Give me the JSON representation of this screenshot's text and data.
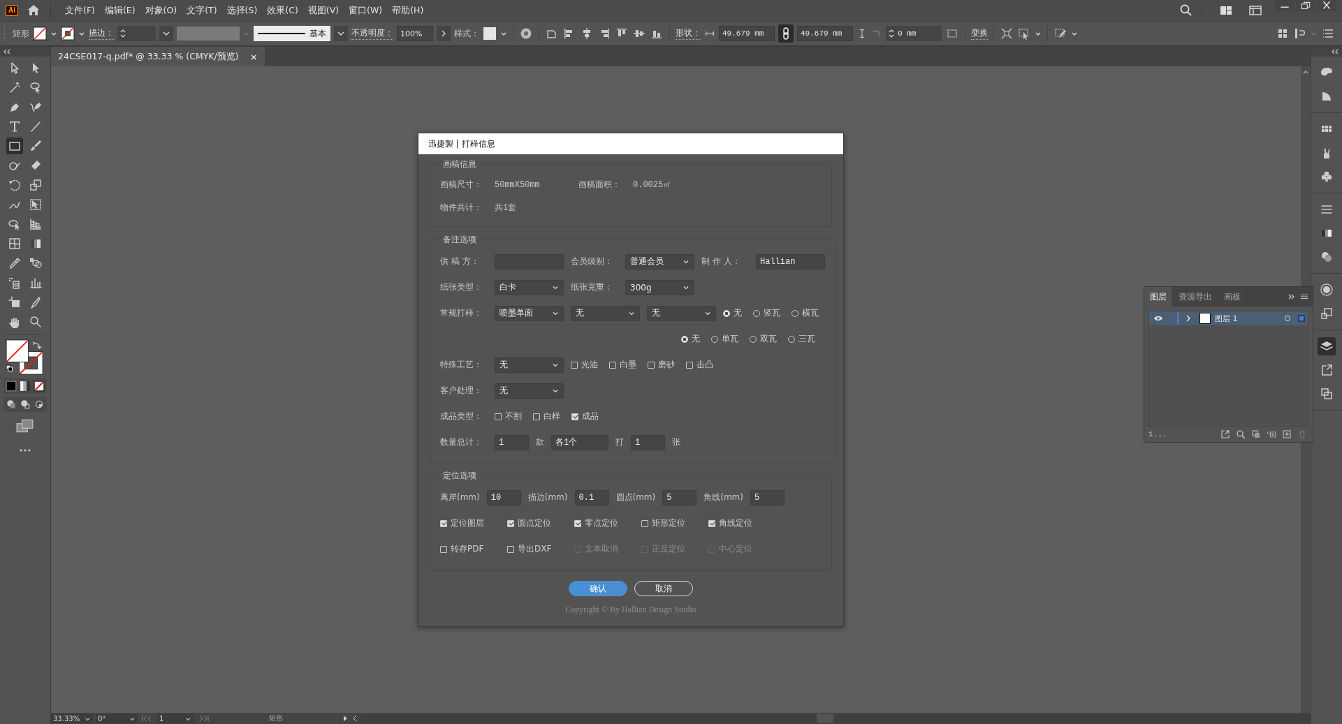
{
  "menu_bar": {
    "app_badge": "Ai",
    "items": [
      "文件(F)",
      "编辑(E)",
      "对象(O)",
      "文字(T)",
      "选择(S)",
      "效果(C)",
      "视图(V)",
      "窗口(W)",
      "帮助(H)"
    ]
  },
  "control_bar": {
    "object_type": "矩形",
    "stroke_label": "描边：",
    "stroke_style": "基本",
    "opacity_label": "不透明度：",
    "opacity": "100%",
    "style_label": "样式：",
    "shape_label": "形状：",
    "width": "49.679 mm",
    "height": "49.679 mm",
    "corner": "0 mm",
    "transform_label": "变换"
  },
  "document_tab": {
    "title": "24CSE017-q.pdf* @ 33.33 % (CMYK/预览)",
    "close": "×"
  },
  "tools": [
    {
      "kind": "select",
      "selected": false
    },
    {
      "kind": "direct",
      "selected": false
    },
    {
      "kind": "wand",
      "selected": false
    },
    {
      "kind": "lasso",
      "selected": false
    },
    {
      "kind": "pen",
      "selected": false
    },
    {
      "kind": "curvature",
      "selected": false
    },
    {
      "kind": "type",
      "selected": false
    },
    {
      "kind": "line",
      "selected": false
    },
    {
      "kind": "rect",
      "selected": true
    },
    {
      "kind": "brush",
      "selected": false
    },
    {
      "kind": "shaper",
      "selected": false
    },
    {
      "kind": "eraser",
      "selected": false
    },
    {
      "kind": "rotate",
      "selected": false
    },
    {
      "kind": "scale",
      "selected": false
    },
    {
      "kind": "warp",
      "selected": false
    },
    {
      "kind": "freetransform",
      "selected": false
    },
    {
      "kind": "shapebuilder",
      "selected": false
    },
    {
      "kind": "perspective",
      "selected": false
    },
    {
      "kind": "mesh",
      "selected": false
    },
    {
      "kind": "gradient",
      "selected": false
    },
    {
      "kind": "eyedropper",
      "selected": false
    },
    {
      "kind": "blend",
      "selected": false
    },
    {
      "kind": "sprayer",
      "selected": false
    },
    {
      "kind": "graph",
      "selected": false
    },
    {
      "kind": "artboard",
      "selected": false
    },
    {
      "kind": "knife",
      "selected": false
    },
    {
      "kind": "hand",
      "selected": false
    },
    {
      "kind": "zoom",
      "selected": false
    }
  ],
  "dialog": {
    "title": "迅捷製 | 打样信息",
    "sections": [
      {
        "title": "画稿信息",
        "rows": [
          {
            "items": [
              {
                "kind": "label",
                "text": "画稿尺寸："
              },
              {
                "kind": "value",
                "text": "50mmX50mm"
              },
              {
                "kind": "label",
                "text": "画稿面积："
              },
              {
                "kind": "value",
                "text": "0.0025㎡"
              }
            ]
          },
          {
            "items": [
              {
                "kind": "label",
                "text": "物件共计："
              },
              {
                "kind": "value",
                "text": "共1套"
              }
            ]
          }
        ]
      },
      {
        "title": "备注选项",
        "rows": [
          {
            "items": [
              {
                "kind": "label",
                "text": "供 稿 方："
              },
              {
                "kind": "input"
              },
              {
                "kind": "label",
                "text": "会员级别："
              },
              {
                "kind": "select",
                "value": "普通会员"
              },
              {
                "kind": "label",
                "text": "制 作 人："
              },
              {
                "kind": "input",
                "value": "Hallian"
              }
            ]
          },
          {
            "items": [
              {
                "kind": "label",
                "text": "纸张类型："
              },
              {
                "kind": "select",
                "value": "白卡"
              },
              {
                "kind": "label",
                "text": "纸张克重："
              },
              {
                "kind": "select",
                "value": "300g"
              }
            ]
          },
          {
            "items": [
              {
                "kind": "label",
                "text": "常规打样："
              },
              {
                "kind": "select",
                "value": "喷墨单面"
              },
              {
                "kind": "select",
                "value": "无"
              },
              {
                "kind": "select",
                "value": "无"
              },
              {
                "kind": "radio",
                "text": "无",
                "selected": true
              },
              {
                "kind": "radio",
                "text": "竖瓦",
                "selected": false
              },
              {
                "kind": "radio",
                "text": "横瓦",
                "selected": false
              }
            ]
          },
          {
            "kind": "radio_group",
            "items": [
              {
                "kind": "radio",
                "text": "无",
                "selected": true
              },
              {
                "kind": "radio",
                "text": "单瓦",
                "selected": false
              },
              {
                "kind": "radio",
                "text": "双瓦",
                "selected": false
              },
              {
                "kind": "radio",
                "text": "三瓦",
                "selected": false
              }
            ]
          },
          {
            "items": [
              {
                "kind": "label",
                "text": "特殊工艺："
              },
              {
                "kind": "select",
                "value": "无"
              },
              {
                "kind": "checkbox",
                "text": "光油",
                "checked": false
              },
              {
                "kind": "checkbox",
                "text": "白墨",
                "checked": false
              },
              {
                "kind": "checkbox",
                "text": "磨砂",
                "checked": false
              },
              {
                "kind": "checkbox",
                "text": "击凸",
                "checked": false
              }
            ]
          },
          {
            "items": [
              {
                "kind": "label",
                "text": "客户处理："
              },
              {
                "kind": "select",
                "value": "无"
              }
            ]
          },
          {
            "items": [
              {
                "kind": "label",
                "text": "成品类型："
              },
              {
                "kind": "checkbox",
                "text": "不割",
                "checked": false
              },
              {
                "kind": "checkbox",
                "text": "白样",
                "checked": false
              },
              {
                "kind": "checkbox",
                "text": "成品",
                "checked": true
              }
            ]
          },
          {
            "items": [
              {
                "kind": "label",
                "text": "数量总计："
              },
              {
                "kind": "short_input",
                "value": "1"
              },
              {
                "kind": "unit",
                "text": "款"
              },
              {
                "kind": "mid_input",
                "value": "各1个"
              },
              {
                "kind": "unit",
                "text": "打"
              },
              {
                "kind": "short_input",
                "value": "1"
              },
              {
                "kind": "unit",
                "text": "张"
              }
            ]
          }
        ]
      },
      {
        "title": "定位选项",
        "rows": [
          {
            "items": [
              {
                "kind": "unit",
                "text": "离岸(mm)"
              },
              {
                "kind": "short_input",
                "value": "10"
              },
              {
                "kind": "unit",
                "text": "描边(mm)"
              },
              {
                "kind": "short_input",
                "value": "0.1"
              },
              {
                "kind": "unit",
                "text": "圆点(mm)"
              },
              {
                "kind": "short_input",
                "value": "5"
              },
              {
                "kind": "unit",
                "text": "角线(mm)"
              },
              {
                "kind": "short_input",
                "value": "5"
              }
            ]
          },
          {
            "kind": "checkbox_grid",
            "items": [
              {
                "kind": "checkbox",
                "text": "定位图层",
                "checked": true
              },
              {
                "kind": "checkbox",
                "text": "圆点定位",
                "checked": true
              },
              {
                "kind": "checkbox",
                "text": "零点定位",
                "checked": true
              },
              {
                "kind": "checkbox",
                "text": "矩形定位",
                "checked": false
              },
              {
                "kind": "checkbox",
                "text": "角线定位",
                "checked": true
              }
            ]
          },
          {
            "kind": "checkbox_grid",
            "items": [
              {
                "kind": "checkbox",
                "text": "转存PDF",
                "checked": false,
                "disabled": false
              },
              {
                "kind": "checkbox",
                "text": "导出DXF",
                "checked": false,
                "disabled": false
              },
              {
                "kind": "checkbox",
                "text": "文本取消",
                "checked": false,
                "disabled": true
              },
              {
                "kind": "checkbox",
                "text": "正反定位",
                "checked": false,
                "disabled": true
              },
              {
                "kind": "checkbox",
                "text": "中心定位",
                "checked": false,
                "disabled": true
              }
            ]
          }
        ]
      }
    ],
    "buttons": [
      {
        "label": "确认",
        "kind": "primary"
      },
      {
        "label": "取消",
        "kind": "secondary"
      }
    ],
    "copyright": "Copyright © By Hallian Design Studio"
  },
  "layers_panel": {
    "tabs": [
      {
        "label": "图层",
        "selected": true
      },
      {
        "label": "资源导出",
        "selected": false
      },
      {
        "label": "画板",
        "selected": false
      }
    ],
    "layers": [
      {
        "name": "图层 1",
        "visible": true,
        "selected": true
      }
    ],
    "count": "1..."
  },
  "dock": [
    {
      "kind": "palette",
      "selected": false
    },
    {
      "kind": "quarter",
      "selected": false
    },
    {
      "kind": "swatches",
      "selected": false
    },
    {
      "kind": "brushes",
      "selected": false
    },
    {
      "kind": "club",
      "selected": false
    },
    {
      "kind": "stroke",
      "selected": false
    },
    {
      "kind": "gradient",
      "selected": false
    },
    {
      "kind": "circles",
      "selected": false
    },
    {
      "kind": "appearance",
      "selected": false
    },
    {
      "kind": "styles",
      "selected": false
    },
    {
      "kind": "layers",
      "selected": true
    },
    {
      "kind": "export",
      "selected": false
    },
    {
      "kind": "artboards",
      "selected": false
    }
  ],
  "status_bar": {
    "zoom": "33.33%",
    "rotation": "0°",
    "artboard": "1",
    "tool": "矩形"
  }
}
